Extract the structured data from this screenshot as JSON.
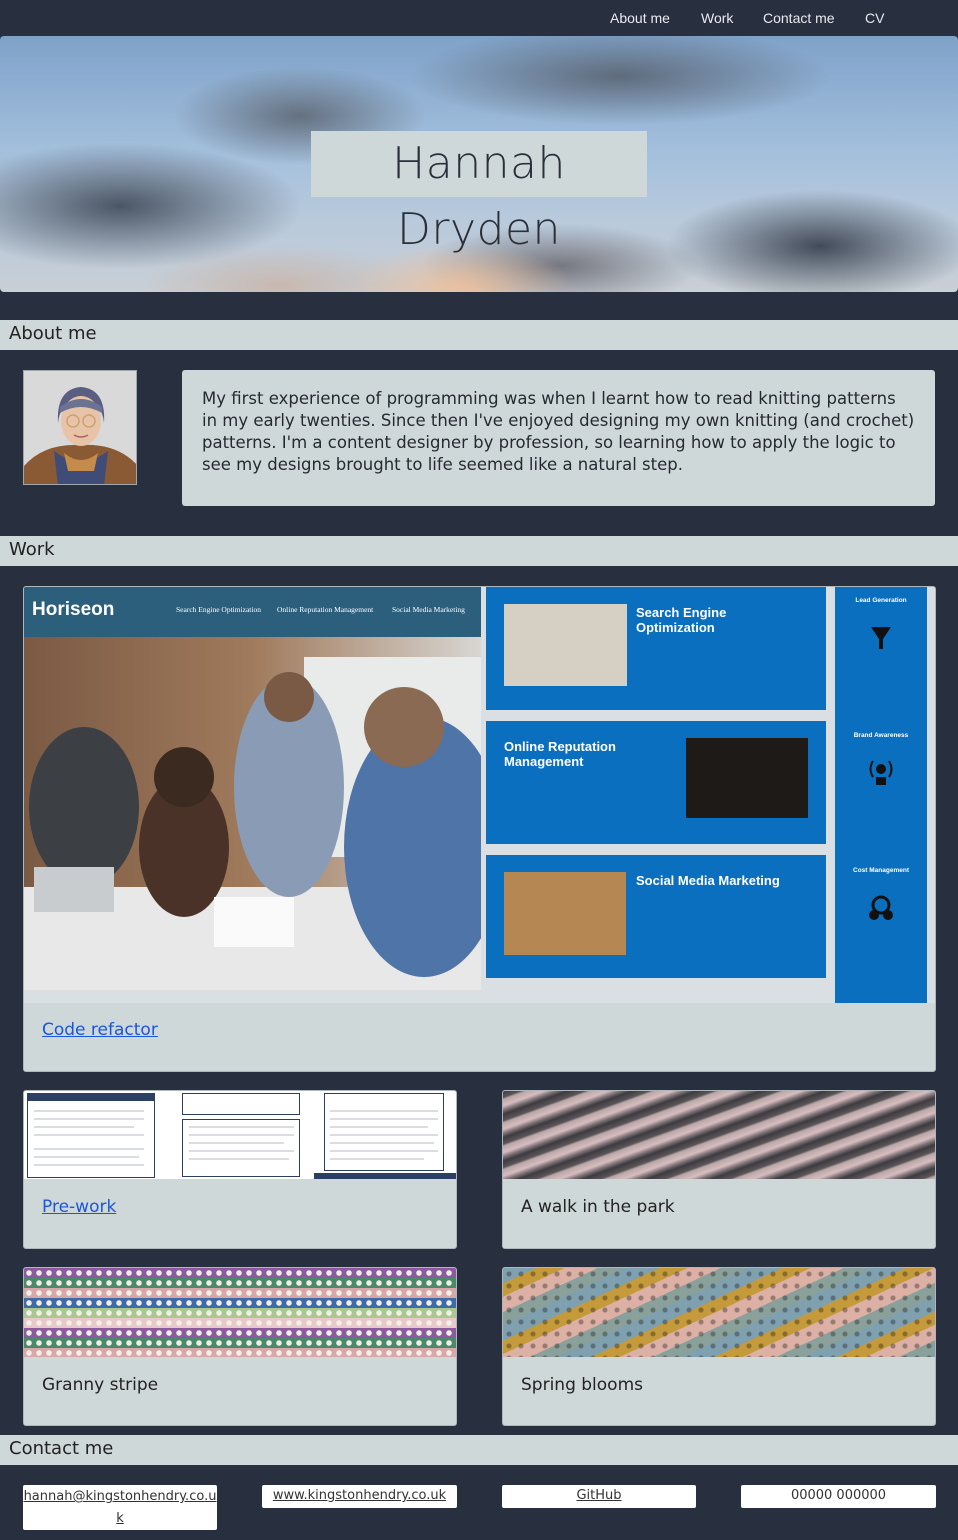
{
  "nav": {
    "items": [
      {
        "label": "About me"
      },
      {
        "label": "Work"
      },
      {
        "label": "Contact me"
      },
      {
        "label": "CV"
      }
    ]
  },
  "hero": {
    "title": "Hannah Dryden"
  },
  "sections": {
    "about": "About me",
    "work": "Work",
    "contact": "Contact me"
  },
  "about": {
    "text": "My first experience of programming was when I learnt how to read knitting patterns in my early twenties. Since then I've enjoyed designing my own knitting (and crochet) patterns. I'm a content designer by profession, so learning how to apply the logic to see my designs brought to life seemed like a natural step."
  },
  "work": {
    "featured": {
      "label": "Code refactor",
      "screenshot": {
        "brand": "Horiseon",
        "nav": [
          "Search Engine Optimization",
          "Online Reputation Management",
          "Social Media Marketing"
        ],
        "panels": [
          {
            "title": "Search Engine Optimization"
          },
          {
            "title": "Online Reputation Management"
          },
          {
            "title": "Social Media Marketing"
          }
        ],
        "side": [
          "Lead Generation",
          "Brand Awareness",
          "Cost Management"
        ]
      }
    },
    "projects": [
      {
        "label": "Pre-work",
        "link": true
      },
      {
        "label": "A walk in the park",
        "link": false
      },
      {
        "label": "Granny stripe",
        "link": false
      },
      {
        "label": "Spring blooms",
        "link": false
      }
    ]
  },
  "contact": {
    "email": "hannah@kingstonhendry.co.uk",
    "website": "www.kingstonhendry.co.uk",
    "github": "GitHub",
    "phone": "00000 000000"
  },
  "colors": {
    "background": "#282f3e",
    "panel": "#cfd8d9",
    "link": "#1a56db",
    "horiseon_blue": "#0a6fbf"
  }
}
